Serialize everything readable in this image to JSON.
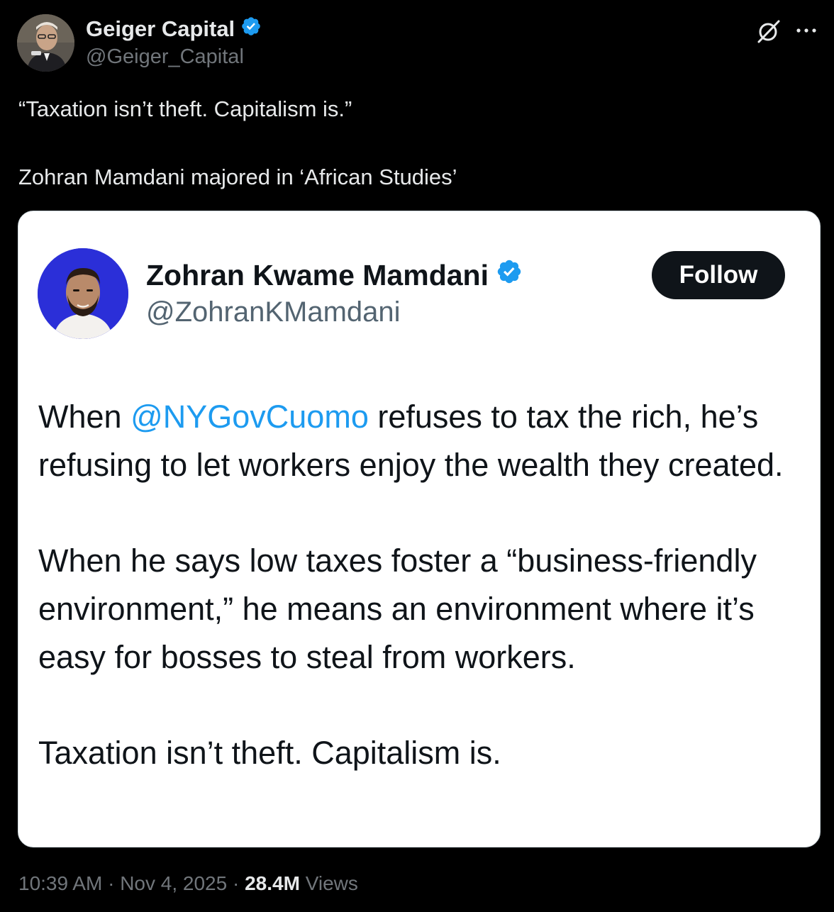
{
  "author": {
    "name": "Geiger Capital",
    "handle": "@Geiger_Capital",
    "verified_color": "#1d9bf0"
  },
  "icons": {
    "grok": "grok-icon",
    "more": "more-icon",
    "verified": "verified-badge-icon"
  },
  "tweet": {
    "line1": "“Taxation isn’t theft. Capitalism is.”",
    "line2": "Zohran Mamdani majored in ‘African Studies’"
  },
  "quoted": {
    "name": "Zohran Kwame Mamdani",
    "handle": "@ZohranKMamdani",
    "follow_label": "Follow",
    "p1_before": "When ",
    "p1_mention": "@NYGovCuomo",
    "p1_after": " refuses to tax the rich, he’s refusing to let workers enjoy the wealth they created.",
    "p2": "When he says low taxes foster a “business-friendly environment,” he means an environment where it’s easy for bosses to steal from workers.",
    "p3": "Taxation isn’t theft. Capitalism is."
  },
  "footer": {
    "time": "10:39 AM",
    "sep1": " · ",
    "date": "Nov 4, 2025",
    "sep2": " · ",
    "views_count": "28.4M",
    "views_label": " Views"
  },
  "colors": {
    "background": "#000000",
    "text": "#e7e9ea",
    "secondary": "#71767b",
    "link": "#1d9bf0"
  }
}
